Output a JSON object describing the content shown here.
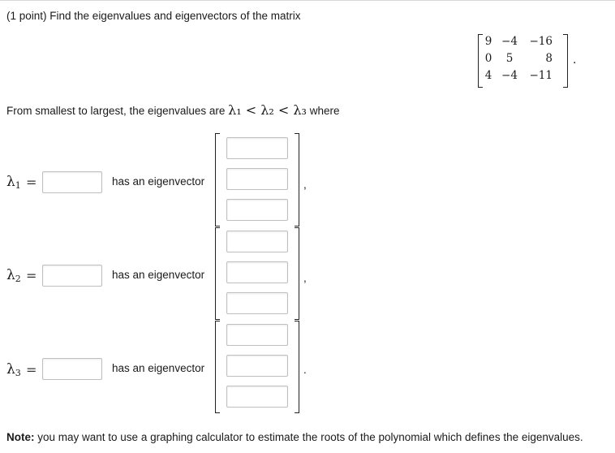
{
  "problem": {
    "header": "(1 point) Find the eigenvalues and eigenvectors of the matrix",
    "matrix": [
      [
        "9",
        "−4",
        "−16"
      ],
      [
        "0",
        "5",
        "8"
      ],
      [
        "4",
        "−4",
        "−11"
      ]
    ],
    "matrix_end": ".",
    "order_prefix": "From smallest to largest, the eigenvalues are",
    "order_math": "λ₁ < λ₂ < λ₃",
    "order_suffix": "where"
  },
  "rows": [
    {
      "lambda": "λ",
      "sub": "1",
      "eq": "=",
      "has_label": "has an eigenvector",
      "trail": ","
    },
    {
      "lambda": "λ",
      "sub": "2",
      "eq": "=",
      "has_label": "has an eigenvector",
      "trail": ","
    },
    {
      "lambda": "λ",
      "sub": "3",
      "eq": "=",
      "has_label": "has an eigenvector",
      "trail": "."
    }
  ],
  "note": {
    "bold": "Note:",
    "text": " you may want to use a graphing calculator to estimate the roots of the polynomial which defines the eigenvalues."
  }
}
